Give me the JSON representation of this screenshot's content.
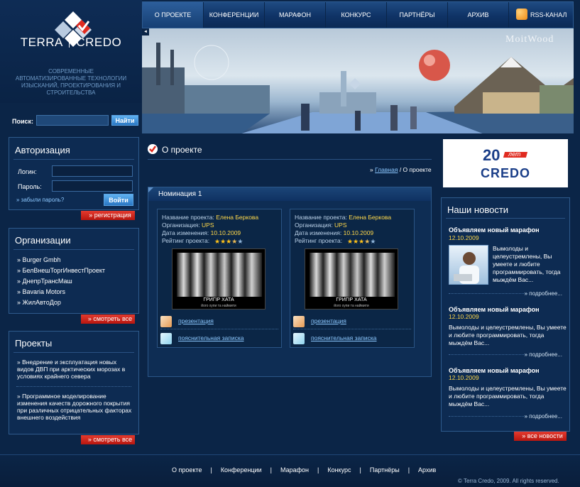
{
  "brand": {
    "name_left": "TERRA",
    "name_right": "CREDO",
    "tagline": "СОВРЕМЕННЫЕ АВТОМАТИЗИРОВАННЫЕ ТЕХНОЛОГИИ ИЗЫСКАНИЙ, ПРОЕКТИРОВАНИЯ И СТРОИТЕЛЬСТВА"
  },
  "nav": {
    "items": [
      "О ПРОЕКТЕ",
      "КОНФЕРЕНЦИИ",
      "МАРАФОН",
      "КОНКУРС",
      "ПАРТНЁРЫ",
      "АРХИВ"
    ],
    "active": "О ПРОЕКТЕ",
    "rss_label": "RSS-КАНАЛ"
  },
  "banner": {
    "watermark": "MoitWood"
  },
  "search": {
    "label": "Поиск:",
    "value": "",
    "button": "Найти"
  },
  "auth": {
    "title": "Авторизация",
    "login_label": "Логин:",
    "password_label": "Пароль:",
    "forgot": "забыли пароль?",
    "login_button": "Войти",
    "register_button": "» регистрация"
  },
  "orgs": {
    "title": "Организации",
    "items": [
      "» Burger Gmbh",
      "» БелВнешТоргИнвестПроект",
      "» ДнепрТрансМаш",
      "» Bavaria Motors",
      "» ЖилАвтоДор"
    ],
    "more_button": "» смотреть все"
  },
  "projects": {
    "title": "Проекты",
    "items": [
      "» Внедрение и эксплуатация новых видов ДВП при арктических морозах в условиях крайнего севера",
      "» Программное моделирование изменения качеств дорожного покрытия при различных отрицательных факторах внешнего воздействия"
    ],
    "more_button": "» смотреть все"
  },
  "main": {
    "title": "О проекте",
    "breadcrumb_home": "Главная",
    "breadcrumb_sep_current": " / О проекте",
    "breadcrumb_prefix": "» ",
    "nomination": "Номинация 1",
    "cards": [
      {
        "name_label": "Название проекта:",
        "name": "Елена Беркова",
        "org_label": "Организация:",
        "org": "UPS",
        "date_label": "Дата изменения:",
        "date": "10.10.2009",
        "rating_label": "Рейтинг проекта:",
        "rating": 3.5,
        "poster_title": "ГРИГІР ХАТА",
        "poster_sub": "його хупи та наймити",
        "link_presentation": "презентация",
        "link_note": "пояснительная записка"
      },
      {
        "name_label": "Название проекта:",
        "name": "Елена Беркова",
        "org_label": "Организация:",
        "org": "UPS",
        "date_label": "Дата изменения:",
        "date": "10.10.2009",
        "rating_label": "Рейтинг проекта:",
        "rating": 3.5,
        "poster_title": "ГРИГІР ХАТА",
        "poster_sub": "його хупи та наймити",
        "link_presentation": "презентация",
        "link_note": "пояснительная записка"
      }
    ]
  },
  "credo_ad": {
    "number": "20",
    "let": "лет",
    "name": "CREDO"
  },
  "news": {
    "title": "Наши новости",
    "items": [
      {
        "title": "Объявляем новый марафон",
        "date": "12.10.2009",
        "text": "Вымолоды и целеустремлены, Вы умеете и любите программировать, тогда мыждём Вас...",
        "more": "» подробнее..."
      },
      {
        "title": "Объявляем новый марафон",
        "date": "12.10.2009",
        "text": "Вымолоды и целеустремлены, Вы умеете и любите программировать, тогда мыждём Вас...",
        "more": "» подробнее..."
      },
      {
        "title": "Объявляем новый марафон",
        "date": "12.10.2009",
        "text": "Вымолоды и целеустремлены, Вы умеете и любите программировать, тогда мыждём Вас...",
        "more": "» подробнее..."
      }
    ],
    "all_button": "» все новости"
  },
  "footer": {
    "links": [
      "О проекте",
      "Конференции",
      "Марафон",
      "Конкурс",
      "Партнёры",
      "Архив"
    ],
    "separator": "|",
    "copyright": "© Terra Credo, 2009. All rights reserved."
  },
  "colors": {
    "accent_red": "#d42a1f",
    "link_blue": "#8cc8ff",
    "highlight_yellow": "#ffd84a",
    "bg_navy": "#0b2547"
  }
}
